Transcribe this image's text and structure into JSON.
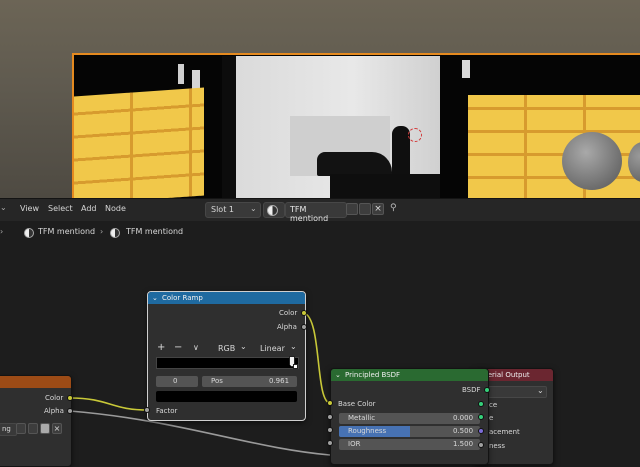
{
  "menu": {
    "view": "View",
    "select": "Select",
    "add": "Add",
    "node": "Node",
    "slot": "Slot 1",
    "material_name": "TFM mentiond"
  },
  "breadcrumb": {
    "item1": "TFM mentiond",
    "item2": "TFM mentiond"
  },
  "color_ramp": {
    "title": "Color Ramp",
    "out_color": "Color",
    "out_alpha": "Alpha",
    "plus": "+",
    "minus": "−",
    "chevron": "∨",
    "color_mode": "RGB",
    "interpolation": "Linear",
    "stop_index": "0",
    "pos_label": "Pos",
    "pos_value": "0.961",
    "in_factor": "Factor"
  },
  "principled": {
    "title": "Principled BSDF",
    "out_bsdf": "BSDF",
    "base_color": "Base Color",
    "metallic_label": "Metallic",
    "metallic_value": "0.000",
    "roughness_label": "Roughness",
    "roughness_value": "0.500",
    "roughness_fill": 0.5,
    "ior_label": "IOR",
    "ior_value": "1.500"
  },
  "material_output": {
    "title": "terial Output",
    "row1": "ce",
    "row2": "e",
    "row3": "acement",
    "row4": "ness"
  },
  "left_node": {
    "out_color": "Color",
    "out_alpha": "Alpha",
    "field_text": "ng"
  },
  "colors": {
    "ramp_header": "#1f6aa0",
    "bsdf_header": "#2a6a31",
    "output_header": "#6b2630",
    "left_header": "#9c4b16",
    "socket_yellow": "#c8c838",
    "socket_grey": "#a0a0a0",
    "roughness_blue": "#4772b3"
  }
}
